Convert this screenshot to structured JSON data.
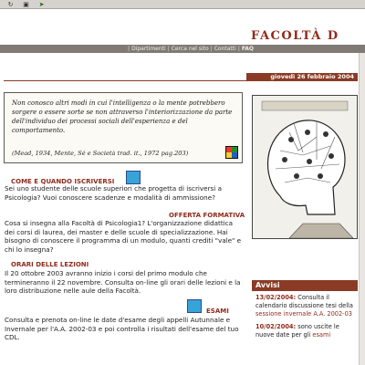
{
  "toolbar": {
    "buttons": [
      "refresh-icon",
      "home-icon",
      "go-icon"
    ]
  },
  "header": {
    "title": "FACOLTÀ D"
  },
  "nav": {
    "items": [
      "Dipartimenti",
      "Cerca nel sito",
      "Contatti",
      "FAQ"
    ]
  },
  "date": "giovedì 26 febbraio 2004",
  "quote": {
    "text": "Non conosco altri modi in cui l'intelligenza o la mente potrebbero sorgere o essere sorte se non attraverso l'interiorizzazione da parte dell'individuo dei processi sociali dell'esperienza e del comportamento.",
    "cite": "(Mead, 1934, Mente, Sé e Società trad. it., 1972 pag.203)"
  },
  "sections": {
    "s1": {
      "title": "COME E QUANDO ISCRIVERSI",
      "body": "Sei uno studente delle scuole superiori che progetta di iscriversi a Psicologia? Vuoi conoscere scadenze e modalità di ammissione?"
    },
    "s2": {
      "title": "OFFERTA FORMATIVA",
      "body": "Cosa si insegna alla Facoltà di Psicologia1? L'organizzazione didattica dei corsi di laurea, dei master e delle scuole di specializzazione. Hai bisogno di conoscere il programma di un modulo, quanti crediti \"vale\" e chi lo insegna?"
    },
    "s3": {
      "title": "ORARI DELLE LEZIONI",
      "body": "Il 20 ottobre 2003 avranno inizio i corsi del primo modulo che termineranno il 22 novembre. Consulta on-line gli orari delle lezioni e la loro distribuzione nelle aule della Facoltà."
    },
    "s4": {
      "title": "ESAMI",
      "body": "Consulta e prenota on-line le date d'esame degli appelli Autunnale e Invernale per l'A.A. 2002-03 e poi controlla i risultati dell'esame del tuo CDL."
    }
  },
  "avvisi": {
    "title": "Avvisi",
    "items": [
      {
        "date": "13/02/2004:",
        "text": " Consulta il calendario discussione tesi della ",
        "link": "sessione invernale A.A. 2002-03"
      },
      {
        "date": "10/02/2004:",
        "text": " sono uscite le nuove date per gli ",
        "link": "esami"
      }
    ]
  },
  "colors": {
    "accent": "#8f2b1c",
    "nav_bg": "#7f7a74",
    "date_bg": "#8a3b26"
  }
}
